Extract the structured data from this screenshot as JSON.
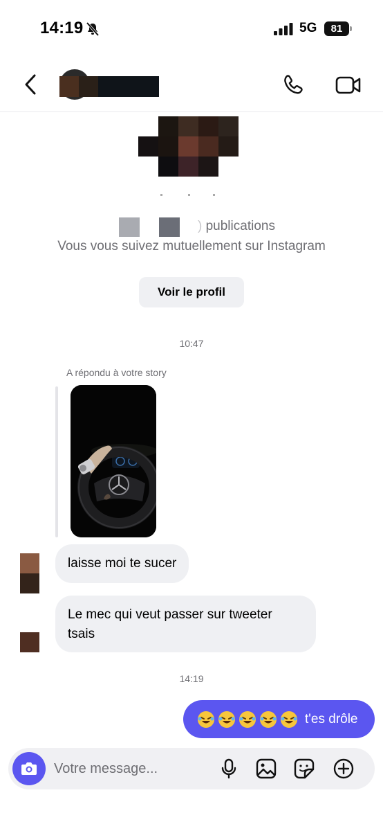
{
  "status_bar": {
    "time": "14:19",
    "network": "5G",
    "battery": "81",
    "icons": [
      "bell-slash-icon",
      "signal-icon",
      "battery-icon"
    ]
  },
  "header": {
    "icons": [
      "back-chevron-icon",
      "phone-icon",
      "video-camera-icon"
    ]
  },
  "profile": {
    "publications_label": "publications",
    "stats_partial_digit": ")",
    "mutual_text": "Vous vous suivez mutuellement sur Instagram",
    "view_profile_button": "Voir le profil"
  },
  "conversation": {
    "timestamp_1": "10:47",
    "story_reply_label": "A répondu à votre story",
    "messages_in": [
      {
        "text": "laisse moi te sucer"
      },
      {
        "text_line1": "Le mec qui veut passer sur tweeter",
        "text_line2": "tsais"
      }
    ],
    "timestamp_2": "14:19",
    "message_out": {
      "emoji": [
        "🤣",
        "🤣",
        "🤣",
        "🤣",
        "🤣"
      ],
      "text": "t'es drôle"
    }
  },
  "composer": {
    "placeholder": "Votre message...",
    "icons": [
      "camera-icon",
      "microphone-icon",
      "image-icon",
      "sticker-icon",
      "add-icon"
    ]
  },
  "colors": {
    "accent": "#5b56f0",
    "bubble_in": "#eff0f3",
    "secondary_text": "#6e6e73"
  }
}
